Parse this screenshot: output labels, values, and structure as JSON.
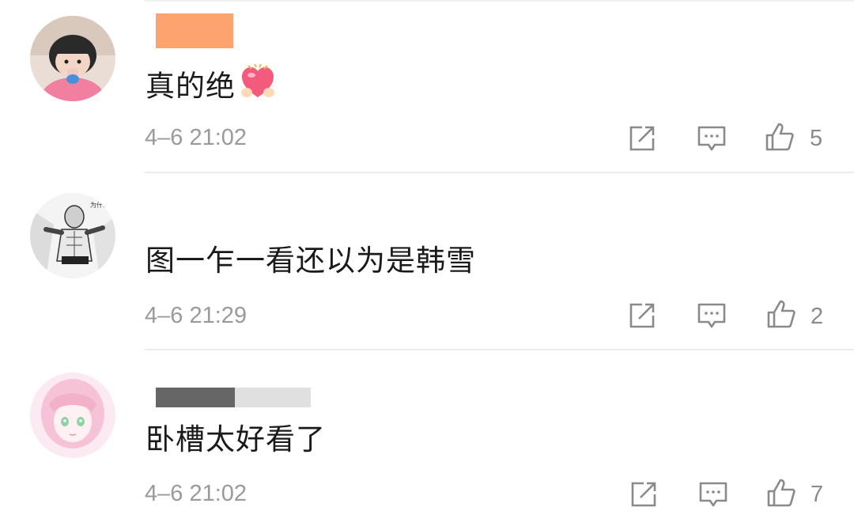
{
  "comments": [
    {
      "text": "真的绝",
      "emoji": "heart-with-hands-emoji",
      "timestamp": "4–6 21:02",
      "likes": "5",
      "name_bar_color": "#fda36f",
      "avatar": "girl-avatar"
    },
    {
      "text": "图一乍一看还以为是韩雪",
      "timestamp": "4–6 21:29",
      "likes": "2",
      "name_bar_color": "#ffffff",
      "avatar": "manga-avatar"
    },
    {
      "text": "卧槽太好看了",
      "timestamp": "4–6 21:02",
      "likes": "7",
      "name_bar_color": "#666666",
      "avatar": "anime-girl-avatar"
    }
  ],
  "icons": {
    "repost": "repost-icon",
    "reply": "reply-icon",
    "like": "thumbs-up-icon"
  },
  "colors": {
    "text": "#1a1a1a",
    "meta": "#9a9a9a",
    "icon": "#8a8a8a",
    "divider": "#ececec"
  }
}
